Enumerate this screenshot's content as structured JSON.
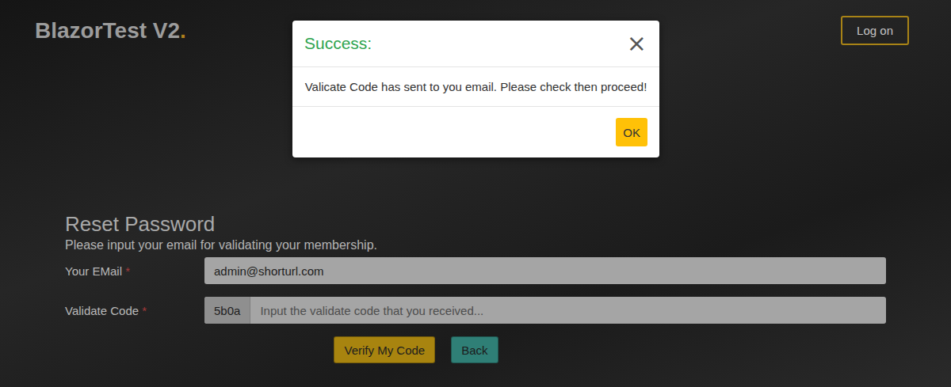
{
  "header": {
    "logo": "BlazorTest V2",
    "logo_dot": ".",
    "login_button": "Log on"
  },
  "form": {
    "title": "Reset Password",
    "subtitle": "Please input your email for validating your membership.",
    "fields": [
      {
        "label": "Your EMail",
        "required_mark": "*",
        "prefix": "",
        "value": "admin@shorturl.com",
        "placeholder": ""
      },
      {
        "label": "Validate Code",
        "required_mark": "*",
        "prefix": "5b0a",
        "value": "",
        "placeholder": "Input the validate code that you received..."
      }
    ],
    "buttons": [
      {
        "label": "Verify My Code",
        "kind": "primary"
      },
      {
        "label": "Back",
        "kind": "secondary"
      }
    ]
  },
  "modal": {
    "title": "Success:",
    "close": "×",
    "message": "Valicate Code has sent to you email. Please check then proceed!",
    "buttons": [
      "OK"
    ]
  }
}
